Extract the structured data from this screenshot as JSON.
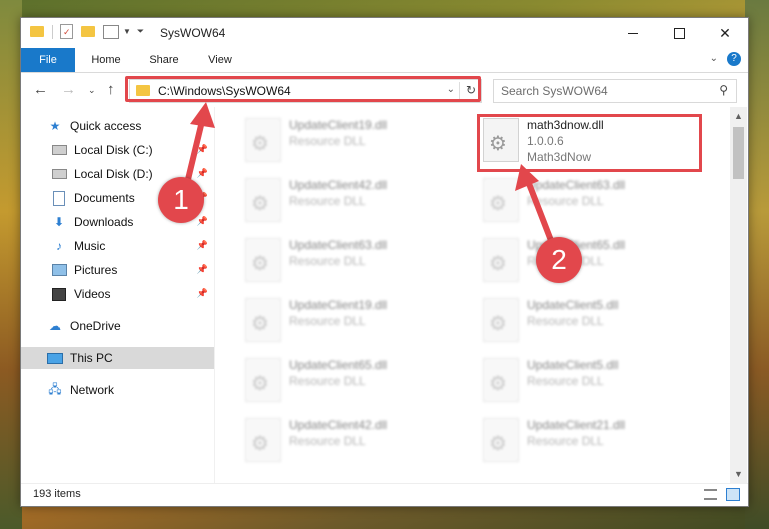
{
  "window": {
    "title": "SysWOW64"
  },
  "ribbon": {
    "tabs": [
      "File",
      "Home",
      "Share",
      "View"
    ]
  },
  "navbar": {
    "address": "C:\\Windows\\SysWOW64",
    "search_placeholder": "Search SysWOW64"
  },
  "sidebar": {
    "items": [
      {
        "label": "Quick access",
        "icon": "star-icon",
        "pinned": false
      },
      {
        "label": "Local Disk (C:)",
        "icon": "drive-icon",
        "pinned": true
      },
      {
        "label": "Local Disk (D:)",
        "icon": "drive-icon",
        "pinned": true
      },
      {
        "label": "Documents",
        "icon": "documents-icon",
        "pinned": true
      },
      {
        "label": "Downloads",
        "icon": "download-icon",
        "pinned": true
      },
      {
        "label": "Music",
        "icon": "music-icon",
        "pinned": true
      },
      {
        "label": "Pictures",
        "icon": "pictures-icon",
        "pinned": true
      },
      {
        "label": "Videos",
        "icon": "videos-icon",
        "pinned": true
      },
      {
        "label": "OneDrive",
        "icon": "cloud-icon",
        "pinned": false
      },
      {
        "label": "This PC",
        "icon": "computer-icon",
        "pinned": false,
        "selected": true
      },
      {
        "label": "Network",
        "icon": "network-icon",
        "pinned": false
      }
    ]
  },
  "files": {
    "left": [
      {
        "name": "UpdateClient19.dll",
        "type": "Resource DLL"
      },
      {
        "name": "UpdateClient42.dll",
        "type": "Resource DLL"
      },
      {
        "name": "UpdateClient63.dll",
        "type": "Resource DLL"
      },
      {
        "name": "UpdateClient19.dll",
        "type": "Resource DLL"
      },
      {
        "name": "UpdateClient65.dll",
        "type": "Resource DLL"
      },
      {
        "name": "UpdateClient42.dll",
        "type": "Resource DLL"
      }
    ],
    "right": [
      {
        "name": "math3dnow.dll",
        "type": "1.0.0.6",
        "extra": "Math3dNow"
      },
      {
        "name": "UpdateClient63.dll",
        "type": "Resource DLL"
      },
      {
        "name": "UpdateClient65.dll",
        "type": "Resource DLL"
      },
      {
        "name": "UpdateClient5.dll",
        "type": "Resource DLL"
      },
      {
        "name": "UpdateClient5.dll",
        "type": "Resource DLL"
      },
      {
        "name": "UpdateClient21.dll",
        "type": "Resource DLL"
      }
    ]
  },
  "status": {
    "item_count": "193 items"
  },
  "annotations": {
    "badge1": "1",
    "badge2": "2",
    "color": "#e2474c"
  }
}
